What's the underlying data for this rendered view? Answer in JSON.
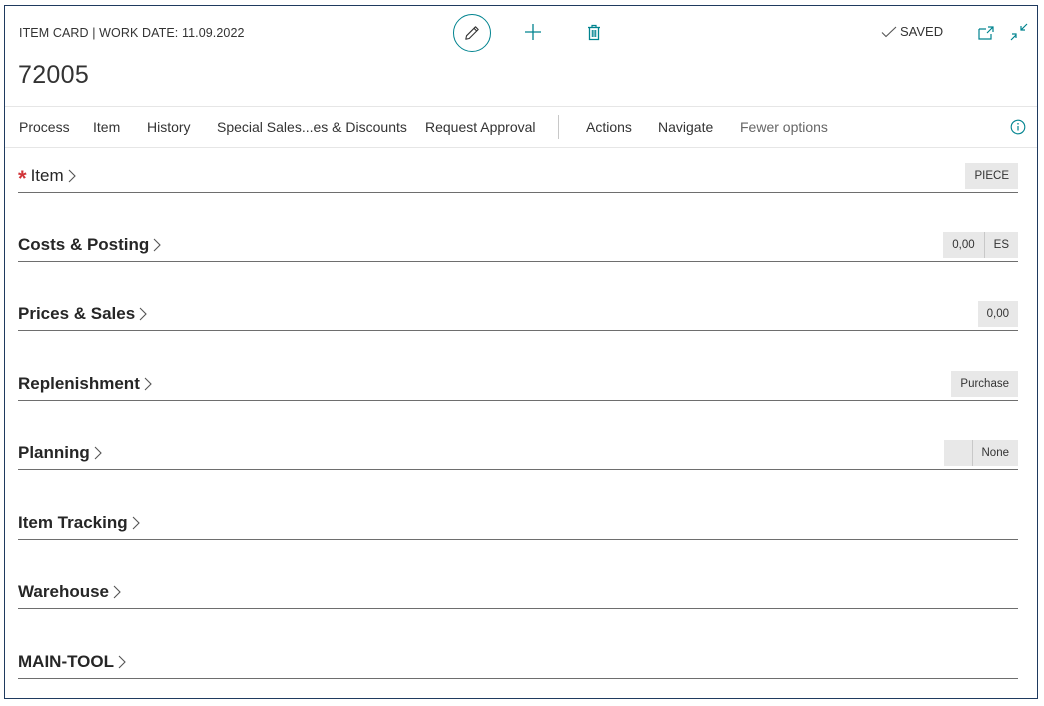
{
  "header": {
    "caption": "ITEM CARD | WORK DATE: 11.09.2022",
    "record_title": "72005",
    "status": "SAVED"
  },
  "icons": {
    "edit": "pencil-icon",
    "new": "plus-icon",
    "delete": "trash-icon",
    "saved": "checkmark-icon",
    "popout": "open-new-window-icon",
    "collapse": "collapse-arrows-icon",
    "info": "info-icon",
    "expand": "chevron-right-icon"
  },
  "colors": {
    "accent": "#00838f",
    "required": "#d13438",
    "frame": "#1f3a5f"
  },
  "actionbar": {
    "items": [
      {
        "label": "Process"
      },
      {
        "label": "Item"
      },
      {
        "label": "History"
      },
      {
        "label": "Special Sales...es & Discounts"
      },
      {
        "label": "Request Approval"
      },
      {
        "label": "Actions"
      },
      {
        "label": "Navigate"
      },
      {
        "label": "Fewer options"
      }
    ]
  },
  "sections": [
    {
      "title": "Item",
      "required": true,
      "summary": [
        "PIECE"
      ]
    },
    {
      "title": "Costs & Posting",
      "summary": [
        "0,00",
        "ES"
      ]
    },
    {
      "title": "Prices & Sales",
      "summary": [
        "0,00"
      ]
    },
    {
      "title": "Replenishment",
      "summary": [
        "Purchase"
      ]
    },
    {
      "title": "Planning",
      "summary": [
        "",
        "None"
      ]
    },
    {
      "title": "Item Tracking",
      "summary": []
    },
    {
      "title": "Warehouse",
      "summary": []
    },
    {
      "title": "MAIN-TOOL",
      "summary": []
    }
  ]
}
